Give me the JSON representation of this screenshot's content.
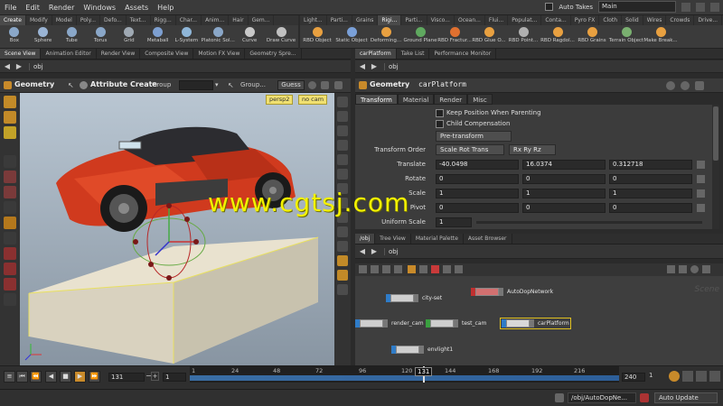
{
  "menu": {
    "items": [
      "File",
      "Edit",
      "Render",
      "Windows",
      "Assets",
      "Help"
    ],
    "auto_takes_label": "Auto Takes",
    "desktop": "Main"
  },
  "shelf_left": {
    "tabs": [
      "Create",
      "Modify",
      "Model",
      "Poly...",
      "Defo...",
      "Text...",
      "Rigg...",
      "Char...",
      "Anim...",
      "Hair",
      "Gem..."
    ],
    "active_tab": "Create",
    "tools": [
      {
        "label": "Box",
        "color": "#8aa7c8"
      },
      {
        "label": "Sphere",
        "color": "#9ab4d4"
      },
      {
        "label": "Tube",
        "color": "#8aa7c8"
      },
      {
        "label": "Torus",
        "color": "#8aa7c8"
      },
      {
        "label": "Grid",
        "color": "#9fa9b3"
      },
      {
        "label": "Metaball",
        "color": "#7d9fd0"
      },
      {
        "label": "L-System",
        "color": "#8fb6d8"
      },
      {
        "label": "Platonic Sol...",
        "color": "#8aa7c8"
      },
      {
        "label": "Curve",
        "color": "#c8c8c8"
      },
      {
        "label": "Draw Curve",
        "color": "#c0c0c0"
      }
    ]
  },
  "shelf_right": {
    "tabs": [
      "Light...",
      "Parti...",
      "Grains",
      "Rigi...",
      "Parti...",
      "Visco...",
      "Ocean...",
      "Flui...",
      "Populat...",
      "Conta...",
      "Pyro FX",
      "Cloth",
      "Solid",
      "Wires",
      "Crowds",
      "Drive..."
    ],
    "active_tab": "Rigi...",
    "tools": [
      {
        "label": "RBD Object",
        "color": "#e8a040"
      },
      {
        "label": "Static Object",
        "color": "#7aa0d8"
      },
      {
        "label": "Deforming...",
        "color": "#e8a040"
      },
      {
        "label": "Ground Plane",
        "color": "#5fa85f"
      },
      {
        "label": "RBD Fractur...",
        "color": "#e07030"
      },
      {
        "label": "RBD Glue O...",
        "color": "#e8a040"
      },
      {
        "label": "RBD Point...",
        "color": "#b0b0b0"
      },
      {
        "label": "RBD Ragdol...",
        "color": "#e8a040"
      },
      {
        "label": "RBD Grains",
        "color": "#e8a040"
      },
      {
        "label": "Terrain Object",
        "color": "#7ab070"
      },
      {
        "label": "Make Break...",
        "color": "#e8a040"
      }
    ]
  },
  "left_pane": {
    "tabs": [
      "Scene View",
      "Animation Editor",
      "Render View",
      "Composite View",
      "Motion FX View",
      "Geometry Spre..."
    ],
    "path": "obj",
    "header": {
      "title": "Geometry",
      "tool": "Attribute Create",
      "group_label": "Group",
      "group_value": "",
      "group_label2": "Group...",
      "guess": "Guess"
    },
    "camera": "persp2",
    "camera2": "no cam"
  },
  "param_pane": {
    "tabs": [
      "carPlatform",
      "Take List",
      "Performance Monitor"
    ],
    "path": "obj",
    "node_type": "Geometry",
    "node_name": "carPlatform",
    "param_tabs": [
      "Transform",
      "Material",
      "Render",
      "Misc"
    ],
    "active_param_tab": "Transform",
    "keep_position": "Keep Position When Parenting",
    "child_comp": "Child Compensation",
    "pre_transform": "Pre-transform",
    "transform_order_label": "Transform Order",
    "transform_order": "Scale Rot Trans",
    "rot_order": "Rx Ry Rz",
    "translate_label": "Translate",
    "translate": [
      "-40.0498",
      "16.0374",
      "0.312718"
    ],
    "rotate_label": "Rotate",
    "rotate": [
      "0",
      "0",
      "0"
    ],
    "scale_label": "Scale",
    "scale": [
      "1",
      "1",
      "1"
    ],
    "pivot_label": "Pivot",
    "pivot": [
      "0",
      "0",
      "0"
    ],
    "uniform_scale_label": "Uniform Scale",
    "uniform_scale": "1"
  },
  "network": {
    "tabs": [
      "/obj",
      "Tree View",
      "Material Palette",
      "Asset Browser"
    ],
    "path": "obj",
    "watermark": "Scene",
    "nodes": [
      {
        "name": "city-set",
        "color": "#c9c9c9",
        "flag": "#2f7cc8"
      },
      {
        "name": "AutoDopNetwork",
        "color": "#d27070",
        "flag": "#c03030"
      },
      {
        "name": "render_cam",
        "color": "#cfcfcf",
        "flag": "#2f7cc8"
      },
      {
        "name": "test_cam",
        "color": "#cfcfcf",
        "flag": "#3aa040"
      },
      {
        "name": "carPlatform",
        "color": "#d9d9d9",
        "flag": "#2f7cc8"
      },
      {
        "name": "envlight1",
        "color": "#cfcfcf",
        "flag": "#2f7cc8"
      }
    ]
  },
  "timeline": {
    "frame_field": "131",
    "step": "1",
    "start": "1",
    "current": "131",
    "end": "240",
    "ticks": [
      "24",
      "48",
      "72",
      "96",
      "120",
      "144",
      "168",
      "192",
      "216"
    ]
  },
  "status": {
    "dop_path": "/obj/AutoDopNe...",
    "update_mode": "Auto Update"
  },
  "overlay": {
    "watermark": "www.cgtsj.com"
  }
}
